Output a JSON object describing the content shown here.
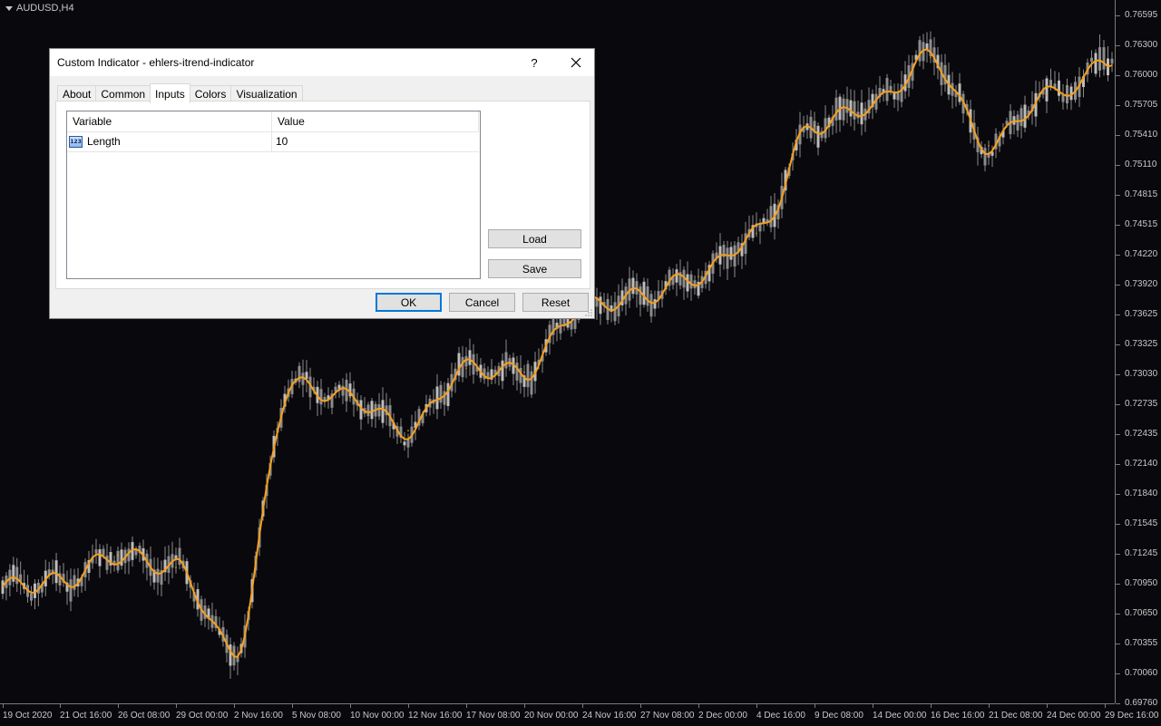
{
  "chart": {
    "symbol": "AUDUSD,H4",
    "price_labels": [
      "0.76595",
      "0.76300",
      "0.76000",
      "0.75705",
      "0.75410",
      "0.75110",
      "0.74815",
      "0.74515",
      "0.74220",
      "0.73920",
      "0.73625",
      "0.73325",
      "0.73030",
      "0.72735",
      "0.72435",
      "0.72140",
      "0.71840",
      "0.71545",
      "0.71245",
      "0.70950",
      "0.70650",
      "0.70355",
      "0.70060",
      "0.69760"
    ],
    "time_labels": [
      "19 Oct 2020",
      "21 Oct 16:00",
      "26 Oct 08:00",
      "29 Oct 00:00",
      "2 Nov 16:00",
      "5 Nov 08:00",
      "10 Nov 00:00",
      "12 Nov 16:00",
      "17 Nov 08:00",
      "20 Nov 00:00",
      "24 Nov 16:00",
      "27 Nov 08:00",
      "2 Dec 00:00",
      "4 Dec 16:00",
      "9 Dec 08:00",
      "14 Dec 00:00",
      "16 Dec 16:00",
      "21 Dec 08:00",
      "24 Dec 00:00",
      "29 Dec 16:00"
    ],
    "colors": {
      "background": "#09080c",
      "candles": "#8c8c8c",
      "indicator": "#f5a01e",
      "axis_text": "#c8c8c8"
    }
  },
  "chart_data": {
    "type": "line",
    "title": "AUDUSD,H4",
    "x": [
      "19 Oct 2020",
      "21 Oct 16:00",
      "26 Oct 08:00",
      "29 Oct 00:00",
      "2 Nov 16:00",
      "5 Nov 08:00",
      "10 Nov 00:00",
      "12 Nov 16:00",
      "17 Nov 08:00",
      "20 Nov 00:00",
      "24 Nov 16:00",
      "27 Nov 08:00",
      "2 Dec 00:00",
      "4 Dec 16:00",
      "9 Dec 08:00",
      "14 Dec 00:00",
      "16 Dec 16:00",
      "21 Dec 08:00",
      "24 Dec 00:00",
      "29 Dec 16:00"
    ],
    "series": [
      {
        "values": [
          0.7092,
          0.7097,
          0.7123,
          0.7111,
          0.7028,
          0.7292,
          0.728,
          0.7247,
          0.7309,
          0.7305,
          0.737,
          0.738,
          0.74,
          0.7443,
          0.755,
          0.757,
          0.7618,
          0.753,
          0.758,
          0.761
        ]
      }
    ],
    "ylim": [
      0.6976,
      0.76595
    ],
    "grid": false
  },
  "dialog": {
    "title": "Custom Indicator - ehlers-itrend-indicator",
    "help_label": "?",
    "tabs": [
      {
        "label": "About",
        "active": false
      },
      {
        "label": "Common",
        "active": false
      },
      {
        "label": "Inputs",
        "active": true
      },
      {
        "label": "Colors",
        "active": false
      },
      {
        "label": "Visualization",
        "active": false
      }
    ],
    "table": {
      "headers": [
        "Variable",
        "Value"
      ],
      "rows": [
        {
          "icon": "integer-type-icon",
          "icon_text": "123",
          "variable": "Length",
          "value": "10"
        }
      ]
    },
    "buttons": {
      "load": "Load",
      "save": "Save",
      "ok": "OK",
      "cancel": "Cancel",
      "reset": "Reset"
    }
  }
}
